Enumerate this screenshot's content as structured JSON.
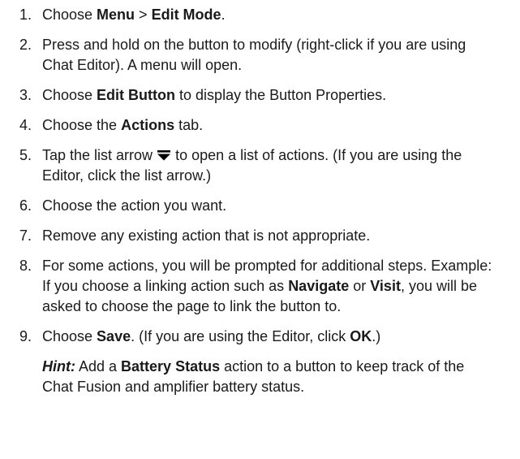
{
  "steps": [
    {
      "num": "1",
      "parts": [
        "Choose ",
        "Menu",
        " > ",
        "Edit Mode",
        "."
      ]
    },
    {
      "num": "2",
      "text": "Press and hold on the button to modify (right-click if you are using Chat Editor). A menu will open."
    },
    {
      "num": "3",
      "parts": [
        "Choose ",
        "Edit Button",
        " to display the Button Properties."
      ]
    },
    {
      "num": "4",
      "parts": [
        "Choose the ",
        "Actions",
        " tab."
      ]
    },
    {
      "num": "5",
      "before": "Tap the list arrow ",
      "icon": "list-arrow-icon",
      "after": " to open a list of actions. (If you are using the Editor, click the list arrow.)"
    },
    {
      "num": "6",
      "text": "Choose the action you want."
    },
    {
      "num": "7",
      "text": "Remove any existing action that is not appropriate."
    },
    {
      "num": "8",
      "parts": [
        "For some actions, you will be prompted for additional steps. Example: If you choose a linking action such as ",
        "Navigate",
        " or ",
        "Visit",
        ", you will be asked to choose the page to link the button to."
      ]
    },
    {
      "num": "9",
      "parts": [
        "Choose ",
        "Save",
        ". (If you are using the Editor, click ",
        "OK",
        ".)"
      ]
    }
  ],
  "hint": {
    "label": "Hint:",
    "parts": [
      " Add a ",
      "Battery Status",
      " action to a button to keep track of the Chat Fusion and amplifier battery status."
    ]
  }
}
